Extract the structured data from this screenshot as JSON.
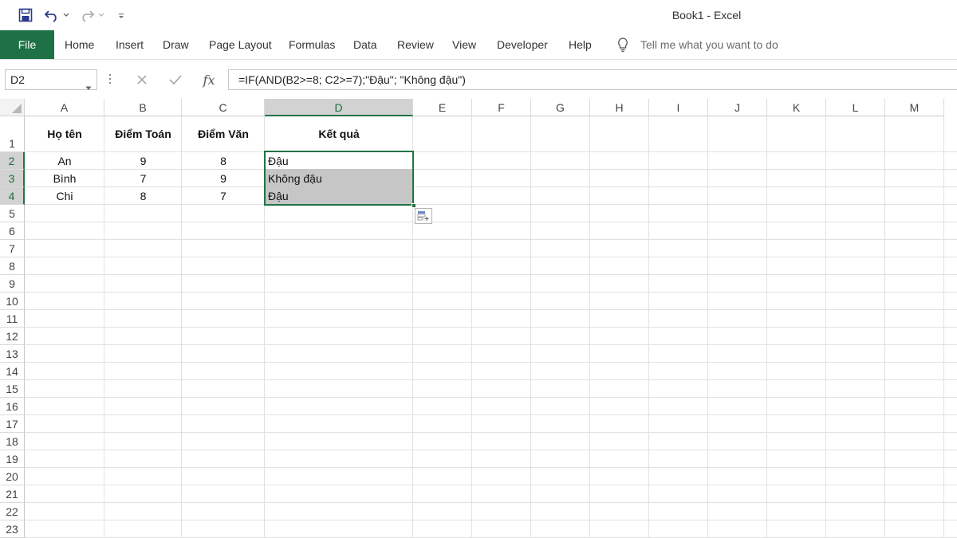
{
  "window": {
    "title": "Book1  -  Excel"
  },
  "qat": {
    "save_icon": "save-icon",
    "undo_icon": "undo-icon",
    "redo_icon": "redo-icon",
    "customize_icon": "customize-qat-icon"
  },
  "ribbon": {
    "tabs": [
      {
        "label": "File"
      },
      {
        "label": "Home"
      },
      {
        "label": "Insert"
      },
      {
        "label": "Draw"
      },
      {
        "label": "Page Layout"
      },
      {
        "label": "Formulas"
      },
      {
        "label": "Data"
      },
      {
        "label": "Review"
      },
      {
        "label": "View"
      },
      {
        "label": "Developer"
      },
      {
        "label": "Help"
      }
    ],
    "tell_me": "Tell me what you want to do"
  },
  "formula_bar": {
    "name_box": "D2",
    "formula": "=IF(AND(B2>=8; C2>=7);\"Đậu\"; \"Không đậu\")",
    "fx_label": "fx"
  },
  "grid": {
    "columns": [
      "A",
      "B",
      "C",
      "D",
      "E",
      "F",
      "G",
      "H",
      "I",
      "J",
      "K",
      "L",
      "M"
    ],
    "rows": [
      "1",
      "2",
      "3",
      "4",
      "5",
      "6",
      "7",
      "8",
      "9",
      "10",
      "11",
      "12",
      "13",
      "14",
      "15",
      "16",
      "17",
      "18",
      "19",
      "20",
      "21",
      "22",
      "23"
    ],
    "selected_column": "D",
    "selected_rows": [
      "2",
      "3",
      "4"
    ],
    "header": {
      "a": "Họ tên",
      "b": "Điểm Toán",
      "c": "Điểm Văn",
      "d": "Kết quả"
    },
    "data": [
      {
        "a": "An",
        "b": "9",
        "c": "8",
        "d": "Đậu"
      },
      {
        "a": "Bình",
        "b": "7",
        "c": "9",
        "d": "Không đậu"
      },
      {
        "a": "Chi",
        "b": "8",
        "c": "7",
        "d": "Đậu"
      }
    ]
  },
  "colors": {
    "accent": "#217346",
    "file_tab": "#1e7145",
    "selection_fill": "#c6c6c6"
  }
}
